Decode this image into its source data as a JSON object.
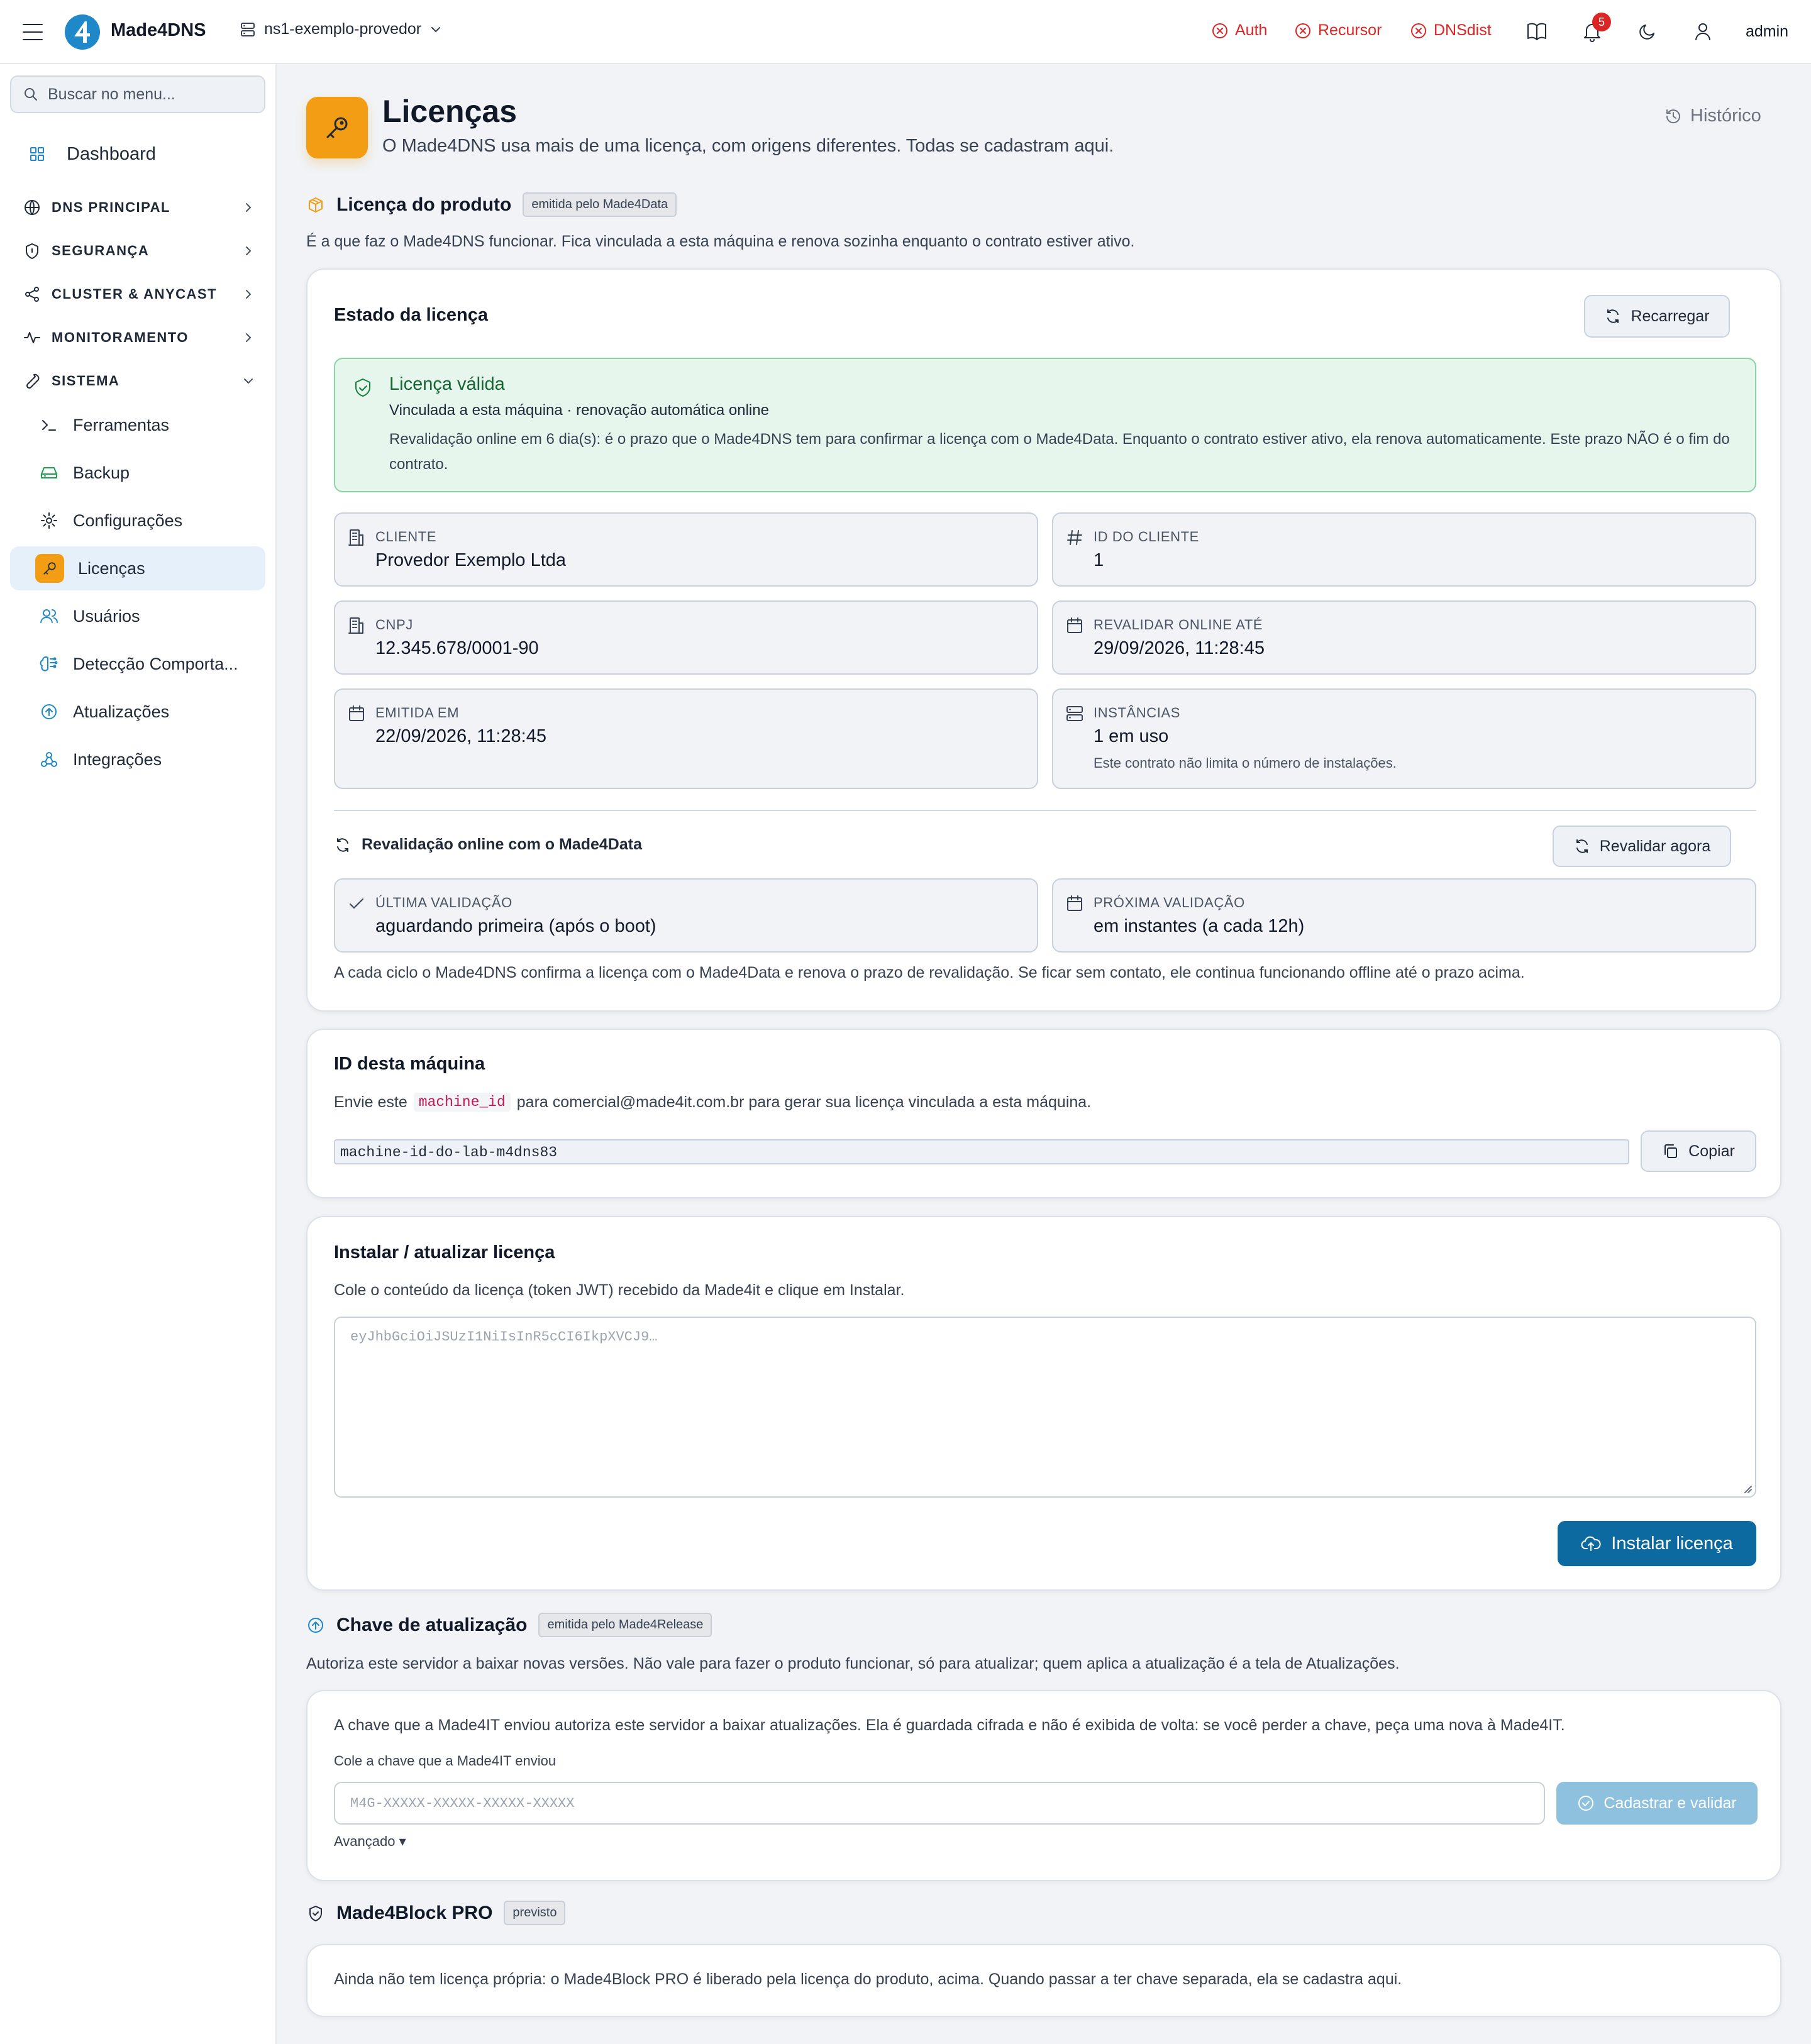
{
  "topbar": {
    "brand": "Made4DNS",
    "server": "ns1-exemplo-provedor",
    "services": [
      "Auth",
      "Recursor",
      "DNSdist"
    ],
    "notifications": "5",
    "user": "admin"
  },
  "sidebar": {
    "search_placeholder": "Buscar no menu...",
    "dashboard": "Dashboard",
    "sections": [
      "DNS PRINCIPAL",
      "SEGURANÇA",
      "CLUSTER & ANYCAST",
      "MONITORAMENTO",
      "SISTEMA"
    ],
    "system_items": [
      "Ferramentas",
      "Backup",
      "Configurações",
      "Licenças",
      "Usuários",
      "Detecção Comporta...",
      "Atualizações",
      "Integrações"
    ]
  },
  "page": {
    "title": "Licenças",
    "subtitle": "O Made4DNS usa mais de uma licença, com origens diferentes. Todas se cadastram aqui.",
    "history": "Histórico"
  },
  "product": {
    "title": "Licença do produto",
    "tag": "emitida pelo Made4Data",
    "desc": "É a que faz o Made4DNS funcionar. Fica vinculada a esta máquina e renova sozinha enquanto o contrato estiver ativo.",
    "state_title": "Estado da licença",
    "reload": "Recarregar",
    "valid_title": "Licença válida",
    "valid_line1": "Vinculada a esta máquina · renovação automática online",
    "valid_line2": "Revalidação online em 6 dia(s): é o prazo que o Made4DNS tem para confirmar a licença com o Made4Data. Enquanto o contrato estiver ativo, ela renova automaticamente. Este prazo NÃO é o fim do contrato.",
    "client_label": "CLIENTE",
    "client": "Provedor Exemplo Ltda",
    "client_id_label": "ID DO CLIENTE",
    "client_id": "1",
    "cnpj_label": "CNPJ",
    "cnpj": "12.345.678/0001-90",
    "revalidate_until_label": "REVALIDAR ONLINE ATÉ",
    "revalidate_until": "29/09/2026, 11:28:45",
    "issued_label": "EMITIDA EM",
    "issued": "22/09/2026, 11:28:45",
    "instances_label": "INSTÂNCIAS",
    "instances": "1 em uso",
    "instances_note": "Este contrato não limita o número de instalações.",
    "reval_title": "Revalidação online com o Made4Data",
    "reval_now": "Revalidar agora",
    "last_label": "ÚLTIMA VALIDAÇÃO",
    "last": "aguardando primeira (após o boot)",
    "next_label": "PRÓXIMA VALIDAÇÃO",
    "next": "em instantes (a cada 12h)",
    "reval_note": "A cada ciclo o Made4DNS confirma a licença com o Made4Data e renova o prazo de revalidação. Se ficar sem contato, ele continua funcionando offline até o prazo acima."
  },
  "machine": {
    "title": "ID desta máquina",
    "text_before": "Envie este",
    "code": "machine_id",
    "text_after": "para comercial@made4it.com.br para gerar sua licença vinculada a esta máquina.",
    "value": "machine-id-do-lab-m4dns83",
    "copy": "Copiar"
  },
  "install": {
    "title": "Instalar / atualizar licença",
    "desc": "Cole o conteúdo da licença (token JWT) recebido da Made4it e clique em Instalar.",
    "placeholder": "eyJhbGciOiJSUzI1NiIsInR5cCI6IkpXVCJ9…",
    "button": "Instalar licença"
  },
  "update_key": {
    "title": "Chave de atualização",
    "tag": "emitida pelo Made4Release",
    "desc": "Autoriza este servidor a baixar novas versões. Não vale para fazer o produto funcionar, só para atualizar; quem aplica a atualização é a tela de Atualizações.",
    "info": "A chave que a Made4IT enviou autoriza este servidor a baixar atualizações. Ela é guardada cifrada e não é exibida de volta: se você perder a chave, peça uma nova à Made4IT.",
    "field_label": "Cole a chave que a Made4IT enviou",
    "placeholder": "M4G-XXXXX-XXXXX-XXXXX-XXXXX",
    "button": "Cadastrar e validar",
    "advanced": "Avançado ▾"
  },
  "block": {
    "title": "Made4Block PRO",
    "tag": "previsto",
    "desc": "Ainda não tem licença própria: o Made4Block PRO é liberado pela licença do produto, acima. Quando passar a ter chave separada, ela se cadastra aqui."
  },
  "colors": {
    "accent": "#f29d13",
    "primary": "#0d6aa0",
    "danger": "#dc2626",
    "success": "#15803d",
    "link": "#1e88c8"
  }
}
